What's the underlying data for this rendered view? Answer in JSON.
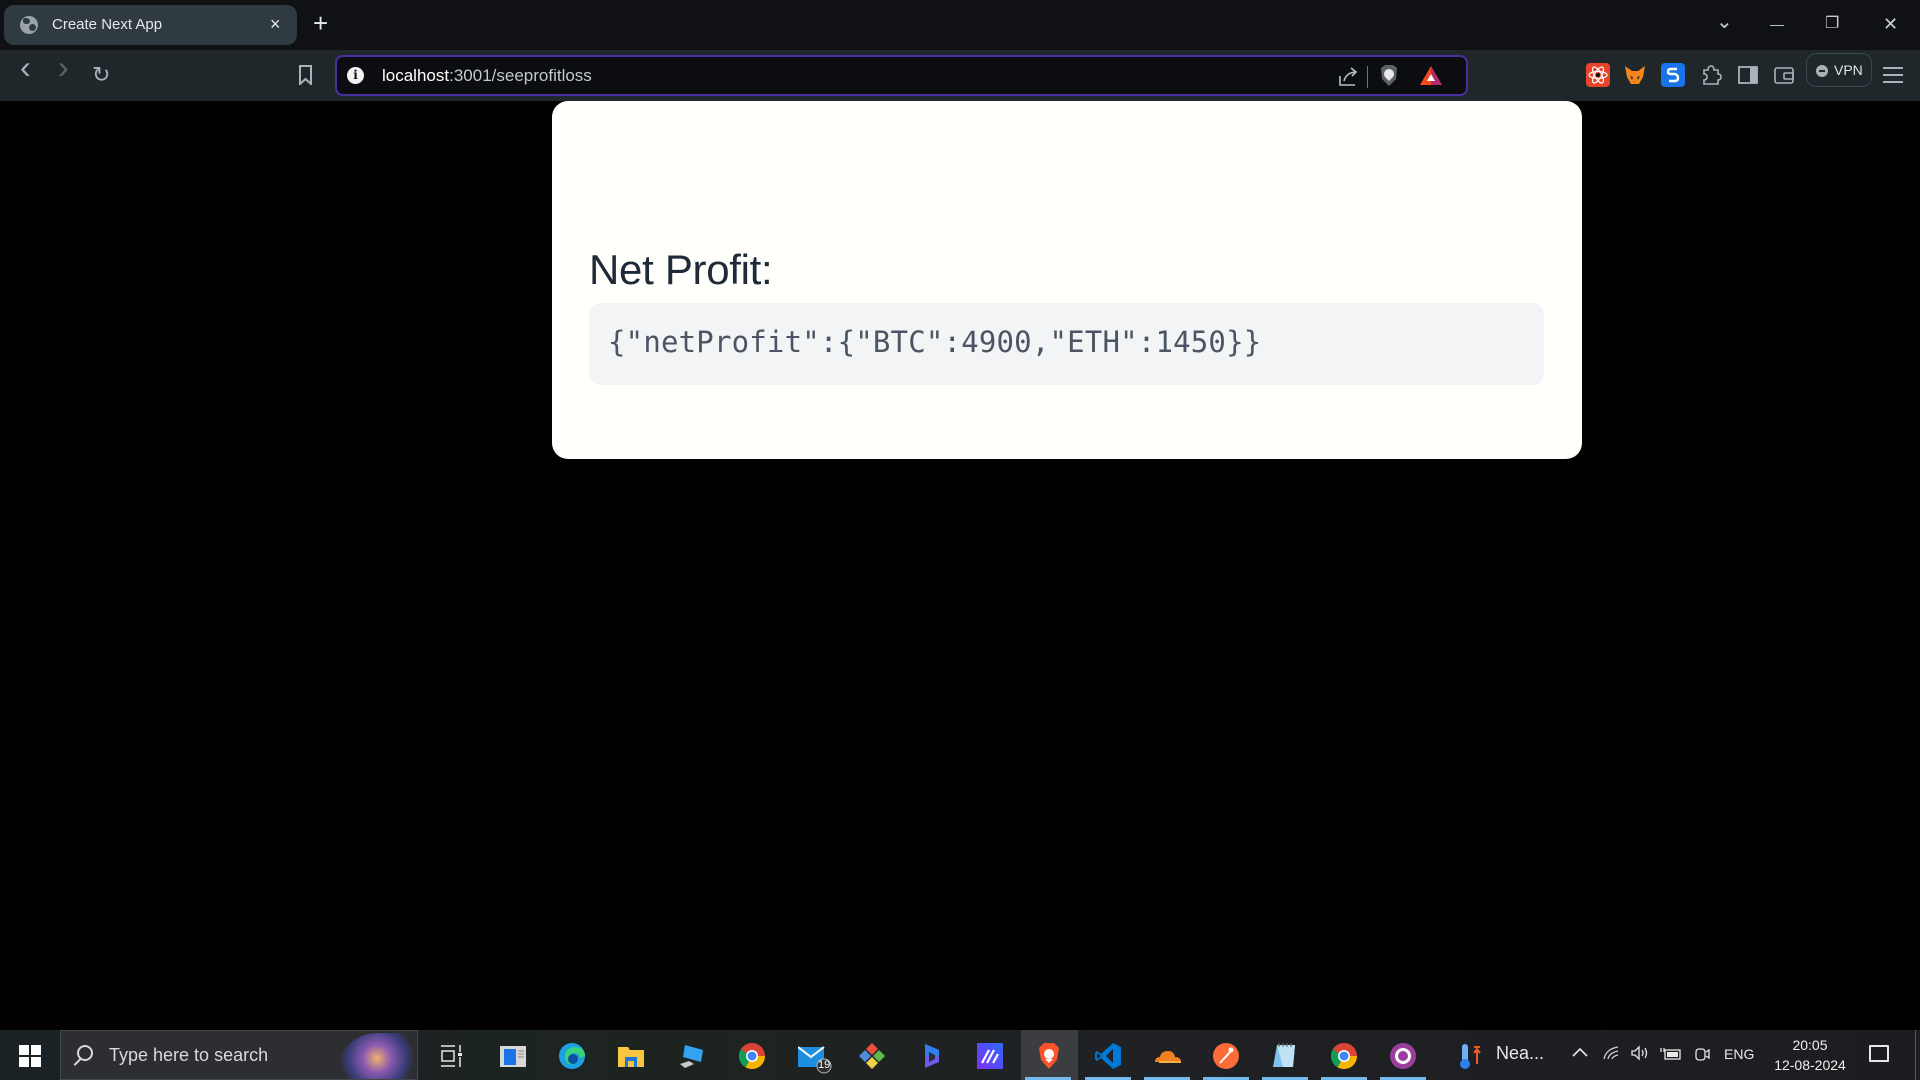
{
  "browser": {
    "tab": {
      "title": "Create Next App",
      "close_glyph": "×",
      "favicon": "globe-icon"
    },
    "new_tab_glyph": "+",
    "window_controls": {
      "tab_search": "⌄",
      "minimize": "—",
      "restore": "❐",
      "close": "✕"
    },
    "nav": {
      "back": "‹",
      "forward": "›",
      "reload": "↻"
    },
    "address": {
      "host": "localhost",
      "rest": ":3001/seeprofitloss",
      "info_glyph": "i"
    },
    "extensions": [
      "react-devtools-icon",
      "metamask-icon",
      "s-extension-icon",
      "extensions-puzzle-icon",
      "sidebar-icon",
      "wallet-icon"
    ],
    "vpn_label": "VPN"
  },
  "page": {
    "heading": "Net Profit:",
    "code": "{\"netProfit\":{\"BTC\":4900,\"ETH\":1450}}",
    "net_profit": {
      "BTC": 4900,
      "ETH": 1450
    }
  },
  "taskbar": {
    "search_placeholder": "Type here to search",
    "weather_label": "Nea...",
    "mail_badge": "19",
    "language": "ENG",
    "time": "20:05",
    "date": "12-08-2024",
    "apps": [
      "task-view",
      "windows-tool",
      "edge",
      "file-explorer",
      "remote-desktop",
      "chrome",
      "mail",
      "git-client",
      "copilot",
      "app-m",
      "brave",
      "vscode",
      "cloudflare",
      "postman",
      "notepad",
      "chrome",
      "github-desktop"
    ]
  }
}
